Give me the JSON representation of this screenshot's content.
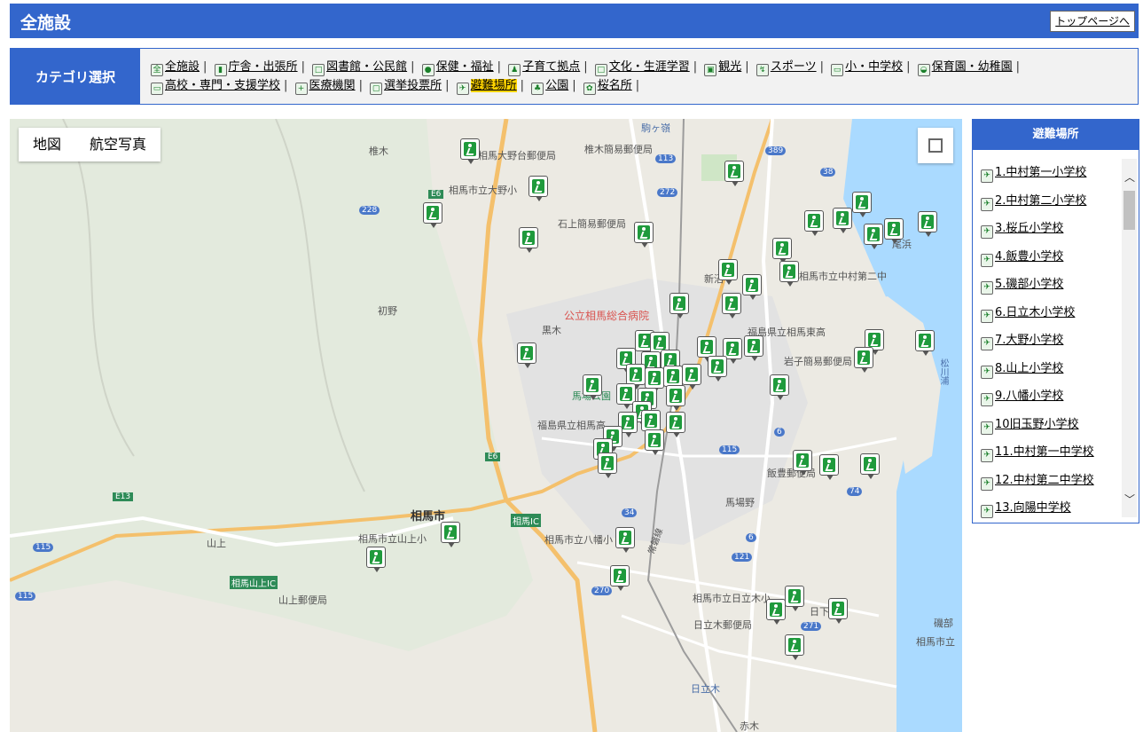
{
  "header": {
    "title": "全施設",
    "top_link": "トップページへ"
  },
  "category": {
    "label": "カテゴリ選択",
    "items": [
      {
        "label": "全施設",
        "icon": "all-icon"
      },
      {
        "label": "庁舎・出張所",
        "icon": "building-icon"
      },
      {
        "label": "図書館・公民館",
        "icon": "library-icon"
      },
      {
        "label": "保健・福祉",
        "icon": "health-icon"
      },
      {
        "label": "子育て拠点",
        "icon": "childcare-icon"
      },
      {
        "label": "文化・生涯学習",
        "icon": "culture-icon"
      },
      {
        "label": "観光",
        "icon": "tourism-icon"
      },
      {
        "label": "スポーツ",
        "icon": "sports-icon"
      },
      {
        "label": "小・中学校",
        "icon": "school-icon"
      },
      {
        "label": "保育園・幼稚園",
        "icon": "nursery-icon"
      },
      {
        "label": "高校・専門・支援学校",
        "icon": "highschool-icon"
      },
      {
        "label": "医療機関",
        "icon": "medical-icon"
      },
      {
        "label": "選挙投票所",
        "icon": "ballot-icon"
      },
      {
        "label": "避難場所",
        "icon": "evacuation-icon",
        "active": true
      },
      {
        "label": "公園",
        "icon": "park-icon"
      },
      {
        "label": "桜名所",
        "icon": "sakura-icon"
      }
    ]
  },
  "map": {
    "types": [
      "地図",
      "航空写真"
    ],
    "labels": {
      "l1": "椎木",
      "l2": "相馬大野台郵便局",
      "l3": "椎木簡易郵便局",
      "l4": "駒ヶ嶺",
      "l5": "相馬市立大野小",
      "l6": "石上簡易郵便局",
      "l7": "初野",
      "l8": "公立相馬総合病院",
      "l9": "黒木",
      "l10": "新沼",
      "l11": "相馬市立中村第二中",
      "l12": "尾浜",
      "l13": "福島県立相馬東高",
      "l14": "岩子簡易郵便局",
      "l15": "松川浦",
      "l16": "馬場公園",
      "l17": "福島県立相馬高",
      "l18": "相馬市",
      "l19": "相馬IC",
      "l20": "相馬市立山上小",
      "l21": "相馬市立八幡小",
      "l22": "飯豊郵便局",
      "l23": "馬場野",
      "l24": "山上",
      "l25": "相馬山上IC",
      "l26": "山上郵便局",
      "l27": "相馬市立日立木小",
      "l28": "日立木郵便局",
      "l29": "日下",
      "l30": "日立木",
      "l31": "磯部",
      "l32": "相馬市立",
      "l33": "常磐線",
      "l34": "赤木"
    },
    "shields": [
      "E6",
      "228",
      "113",
      "272",
      "389",
      "38",
      "E6",
      "6",
      "115",
      "E13",
      "115",
      "115",
      "34",
      "270",
      "121",
      "6",
      "74",
      "271"
    ]
  },
  "side": {
    "title": "避難場所",
    "items": [
      "1.中村第一小学校",
      "2.中村第二小学校",
      "3.桜丘小学校",
      "4.飯豊小学校",
      "5.磯部小学校",
      "6.日立木小学校",
      "7.大野小学校",
      "8.山上小学校",
      "9.八幡小学校",
      "10旧玉野小学校",
      "11.中村第一中学校",
      "12.中村第二中学校",
      "13.向陽中学校"
    ]
  }
}
